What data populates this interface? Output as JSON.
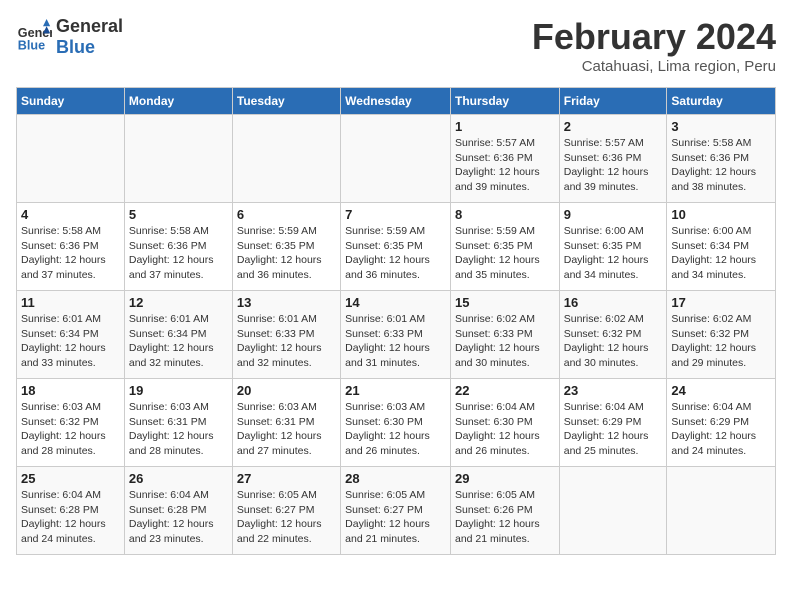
{
  "header": {
    "logo_line1": "General",
    "logo_line2": "Blue",
    "month": "February 2024",
    "location": "Catahuasi, Lima region, Peru"
  },
  "days_of_week": [
    "Sunday",
    "Monday",
    "Tuesday",
    "Wednesday",
    "Thursday",
    "Friday",
    "Saturday"
  ],
  "weeks": [
    [
      {
        "num": "",
        "info": ""
      },
      {
        "num": "",
        "info": ""
      },
      {
        "num": "",
        "info": ""
      },
      {
        "num": "",
        "info": ""
      },
      {
        "num": "1",
        "info": "Sunrise: 5:57 AM\nSunset: 6:36 PM\nDaylight: 12 hours\nand 39 minutes."
      },
      {
        "num": "2",
        "info": "Sunrise: 5:57 AM\nSunset: 6:36 PM\nDaylight: 12 hours\nand 39 minutes."
      },
      {
        "num": "3",
        "info": "Sunrise: 5:58 AM\nSunset: 6:36 PM\nDaylight: 12 hours\nand 38 minutes."
      }
    ],
    [
      {
        "num": "4",
        "info": "Sunrise: 5:58 AM\nSunset: 6:36 PM\nDaylight: 12 hours\nand 37 minutes."
      },
      {
        "num": "5",
        "info": "Sunrise: 5:58 AM\nSunset: 6:36 PM\nDaylight: 12 hours\nand 37 minutes."
      },
      {
        "num": "6",
        "info": "Sunrise: 5:59 AM\nSunset: 6:35 PM\nDaylight: 12 hours\nand 36 minutes."
      },
      {
        "num": "7",
        "info": "Sunrise: 5:59 AM\nSunset: 6:35 PM\nDaylight: 12 hours\nand 36 minutes."
      },
      {
        "num": "8",
        "info": "Sunrise: 5:59 AM\nSunset: 6:35 PM\nDaylight: 12 hours\nand 35 minutes."
      },
      {
        "num": "9",
        "info": "Sunrise: 6:00 AM\nSunset: 6:35 PM\nDaylight: 12 hours\nand 34 minutes."
      },
      {
        "num": "10",
        "info": "Sunrise: 6:00 AM\nSunset: 6:34 PM\nDaylight: 12 hours\nand 34 minutes."
      }
    ],
    [
      {
        "num": "11",
        "info": "Sunrise: 6:01 AM\nSunset: 6:34 PM\nDaylight: 12 hours\nand 33 minutes."
      },
      {
        "num": "12",
        "info": "Sunrise: 6:01 AM\nSunset: 6:34 PM\nDaylight: 12 hours\nand 32 minutes."
      },
      {
        "num": "13",
        "info": "Sunrise: 6:01 AM\nSunset: 6:33 PM\nDaylight: 12 hours\nand 32 minutes."
      },
      {
        "num": "14",
        "info": "Sunrise: 6:01 AM\nSunset: 6:33 PM\nDaylight: 12 hours\nand 31 minutes."
      },
      {
        "num": "15",
        "info": "Sunrise: 6:02 AM\nSunset: 6:33 PM\nDaylight: 12 hours\nand 30 minutes."
      },
      {
        "num": "16",
        "info": "Sunrise: 6:02 AM\nSunset: 6:32 PM\nDaylight: 12 hours\nand 30 minutes."
      },
      {
        "num": "17",
        "info": "Sunrise: 6:02 AM\nSunset: 6:32 PM\nDaylight: 12 hours\nand 29 minutes."
      }
    ],
    [
      {
        "num": "18",
        "info": "Sunrise: 6:03 AM\nSunset: 6:32 PM\nDaylight: 12 hours\nand 28 minutes."
      },
      {
        "num": "19",
        "info": "Sunrise: 6:03 AM\nSunset: 6:31 PM\nDaylight: 12 hours\nand 28 minutes."
      },
      {
        "num": "20",
        "info": "Sunrise: 6:03 AM\nSunset: 6:31 PM\nDaylight: 12 hours\nand 27 minutes."
      },
      {
        "num": "21",
        "info": "Sunrise: 6:03 AM\nSunset: 6:30 PM\nDaylight: 12 hours\nand 26 minutes."
      },
      {
        "num": "22",
        "info": "Sunrise: 6:04 AM\nSunset: 6:30 PM\nDaylight: 12 hours\nand 26 minutes."
      },
      {
        "num": "23",
        "info": "Sunrise: 6:04 AM\nSunset: 6:29 PM\nDaylight: 12 hours\nand 25 minutes."
      },
      {
        "num": "24",
        "info": "Sunrise: 6:04 AM\nSunset: 6:29 PM\nDaylight: 12 hours\nand 24 minutes."
      }
    ],
    [
      {
        "num": "25",
        "info": "Sunrise: 6:04 AM\nSunset: 6:28 PM\nDaylight: 12 hours\nand 24 minutes."
      },
      {
        "num": "26",
        "info": "Sunrise: 6:04 AM\nSunset: 6:28 PM\nDaylight: 12 hours\nand 23 minutes."
      },
      {
        "num": "27",
        "info": "Sunrise: 6:05 AM\nSunset: 6:27 PM\nDaylight: 12 hours\nand 22 minutes."
      },
      {
        "num": "28",
        "info": "Sunrise: 6:05 AM\nSunset: 6:27 PM\nDaylight: 12 hours\nand 21 minutes."
      },
      {
        "num": "29",
        "info": "Sunrise: 6:05 AM\nSunset: 6:26 PM\nDaylight: 12 hours\nand 21 minutes."
      },
      {
        "num": "",
        "info": ""
      },
      {
        "num": "",
        "info": ""
      }
    ]
  ]
}
